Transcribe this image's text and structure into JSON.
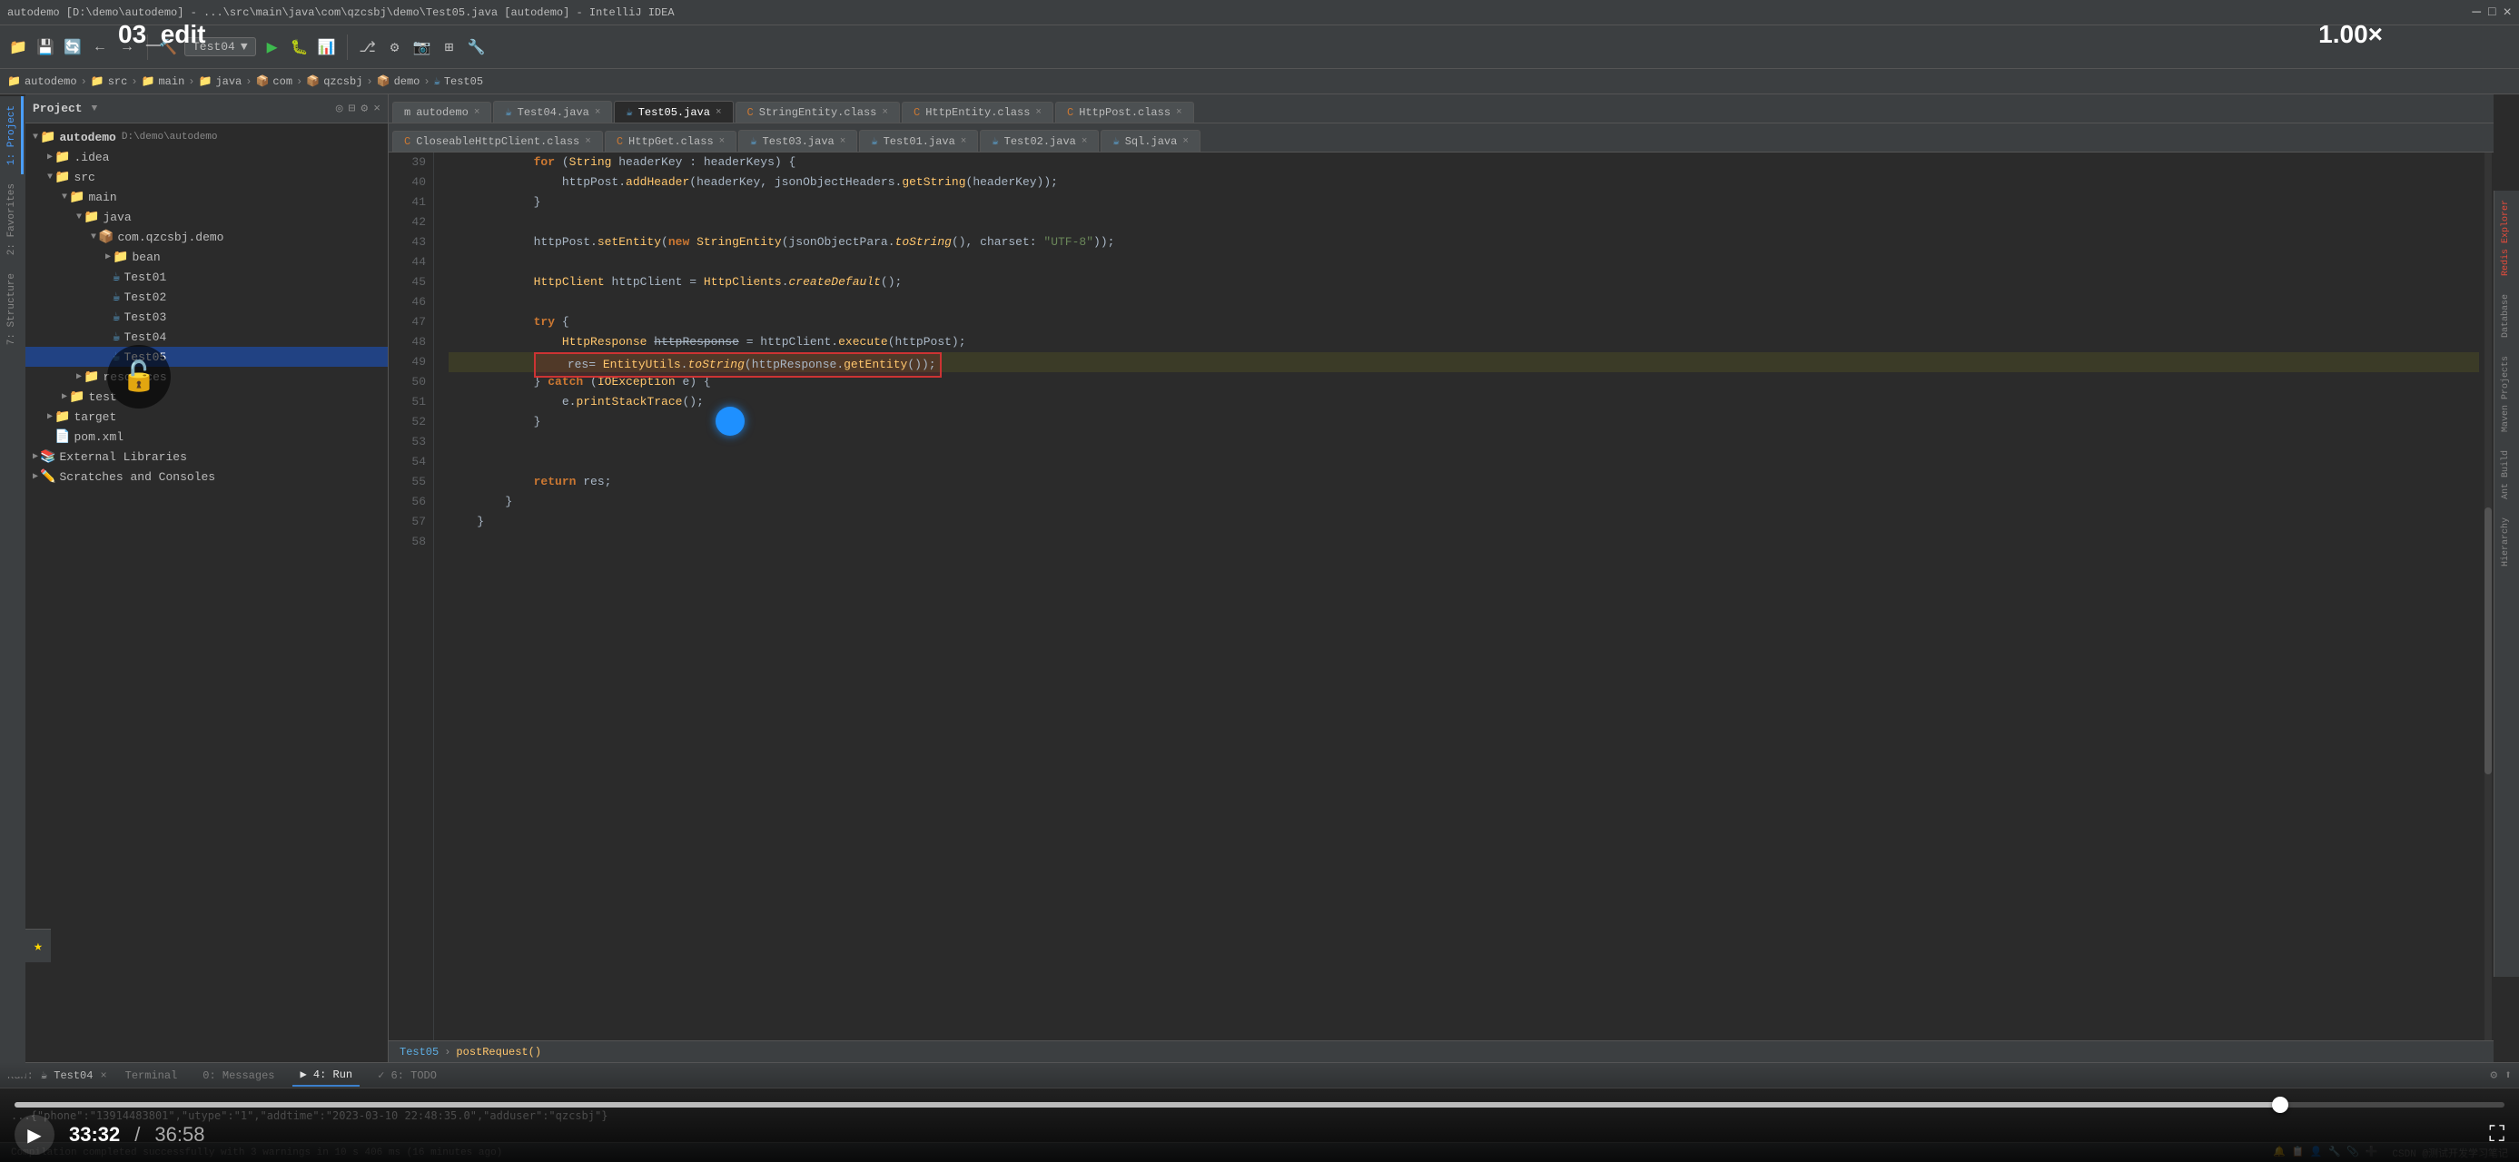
{
  "titleBar": {
    "title": "autodemo [D:\\demo\\autodemo] - ...\\src\\main\\java\\com\\qzcsbj\\demo\\Test05.java [autodemo] - IntelliJ IDEA"
  },
  "overlay": {
    "label": "03_edit",
    "scale": "1.00×"
  },
  "breadcrumb": {
    "items": [
      "autodemo",
      "src",
      "main",
      "java",
      "com",
      "qzcsbj",
      "demo",
      "Test05"
    ]
  },
  "tabBar1": {
    "tabs": [
      {
        "id": "autodemo",
        "label": "autodemo",
        "icon": "m",
        "active": false,
        "closable": true
      },
      {
        "id": "Test04",
        "label": "Test04.java",
        "icon": "☕",
        "active": false,
        "closable": true
      },
      {
        "id": "Test05",
        "label": "Test05.java",
        "icon": "☕",
        "active": true,
        "closable": true
      },
      {
        "id": "StringEntity",
        "label": "StringEntity.class",
        "icon": "C",
        "active": false,
        "closable": true
      },
      {
        "id": "HttpEntity",
        "label": "HttpEntity.class",
        "icon": "C",
        "active": false,
        "closable": true
      },
      {
        "id": "HttpPost",
        "label": "HttpPost.class",
        "icon": "C",
        "active": false,
        "closable": true
      }
    ]
  },
  "tabBar2": {
    "tabs": [
      {
        "id": "CloseableHttpClient",
        "label": "CloseableHttpClient.class",
        "icon": "C",
        "active": false,
        "closable": true
      },
      {
        "id": "HttpGet",
        "label": "HttpGet.class",
        "icon": "C",
        "active": false,
        "closable": true
      },
      {
        "id": "Test03",
        "label": "Test03.java",
        "icon": "☕",
        "active": false,
        "closable": true
      },
      {
        "id": "Test01",
        "label": "Test01.java",
        "icon": "☕",
        "active": false,
        "closable": true
      },
      {
        "id": "Test02",
        "label": "Test02.java",
        "icon": "☕",
        "active": false,
        "closable": true
      },
      {
        "id": "Sql",
        "label": "Sql.java",
        "icon": "☕",
        "active": false,
        "closable": true
      }
    ]
  },
  "codeLines": [
    {
      "num": 39,
      "text": "            for (String headerKey : headerKeys) {",
      "type": "normal"
    },
    {
      "num": 40,
      "text": "                httpPost.addHeader(headerKey, jsonObjectHeaders.getString(headerKey));",
      "type": "normal"
    },
    {
      "num": 41,
      "text": "            }",
      "type": "normal"
    },
    {
      "num": 42,
      "text": "",
      "type": "normal"
    },
    {
      "num": 43,
      "text": "            httpPost.setEntity(new StringEntity(jsonObjectPara.toString(), charset: \"UTF-8\"));",
      "type": "normal"
    },
    {
      "num": 44,
      "text": "",
      "type": "normal"
    },
    {
      "num": 45,
      "text": "            HttpClient httpClient = HttpClients.createDefault();",
      "type": "normal"
    },
    {
      "num": 46,
      "text": "",
      "type": "normal"
    },
    {
      "num": 47,
      "text": "            try {",
      "type": "normal"
    },
    {
      "num": 48,
      "text": "                HttpResponse httpResponse = httpClient.execute(httpPost);",
      "type": "normal"
    },
    {
      "num": 49,
      "text": "                res= EntityUtils.toString(httpResponse.getEntity());",
      "type": "highlighted"
    },
    {
      "num": 50,
      "text": "            } catch (IOException e) {",
      "type": "normal"
    },
    {
      "num": 51,
      "text": "                e.printStackTrace();",
      "type": "normal"
    },
    {
      "num": 52,
      "text": "            }",
      "type": "normal"
    },
    {
      "num": 53,
      "text": "",
      "type": "normal"
    },
    {
      "num": 54,
      "text": "",
      "type": "normal"
    },
    {
      "num": 55,
      "text": "            return res;",
      "type": "normal"
    },
    {
      "num": 56,
      "text": "        }",
      "type": "normal"
    },
    {
      "num": 57,
      "text": "    }",
      "type": "normal"
    },
    {
      "num": 58,
      "text": "",
      "type": "normal"
    }
  ],
  "projectTree": {
    "items": [
      {
        "level": 0,
        "label": "Project",
        "type": "header",
        "expanded": true
      },
      {
        "level": 0,
        "label": "autodemo",
        "sublabel": "D:\\demo\\autodemo",
        "type": "project",
        "expanded": true
      },
      {
        "level": 1,
        "label": ".idea",
        "type": "folder",
        "expanded": false
      },
      {
        "level": 1,
        "label": "src",
        "type": "folder",
        "expanded": true
      },
      {
        "level": 2,
        "label": "main",
        "type": "folder",
        "expanded": true
      },
      {
        "level": 3,
        "label": "java",
        "type": "folder",
        "expanded": true
      },
      {
        "level": 4,
        "label": "com.qzcsbj.demo",
        "type": "package",
        "expanded": true
      },
      {
        "level": 5,
        "label": "bean",
        "type": "folder",
        "expanded": false
      },
      {
        "level": 5,
        "label": "Test01",
        "type": "java",
        "expanded": false
      },
      {
        "level": 5,
        "label": "Test02",
        "type": "java",
        "expanded": false
      },
      {
        "level": 5,
        "label": "Test03",
        "type": "java",
        "expanded": false
      },
      {
        "level": 5,
        "label": "Test04",
        "type": "java",
        "expanded": false
      },
      {
        "level": 5,
        "label": "Test05",
        "type": "java",
        "selected": true,
        "expanded": false
      },
      {
        "level": 3,
        "label": "resources",
        "type": "folder",
        "expanded": false
      },
      {
        "level": 2,
        "label": "test",
        "type": "folder",
        "expanded": false
      },
      {
        "level": 1,
        "label": "target",
        "type": "folder",
        "expanded": false
      },
      {
        "level": 1,
        "label": "pom.xml",
        "type": "xml",
        "expanded": false
      },
      {
        "level": 0,
        "label": "External Libraries",
        "type": "folder",
        "expanded": false
      },
      {
        "level": 0,
        "label": "Scratches and Consoles",
        "type": "folder",
        "expanded": false
      }
    ]
  },
  "methodBreadcrumb": {
    "class": "Test05",
    "method": "postRequest()"
  },
  "bottomTabs": [
    {
      "label": "Terminal",
      "icon": ">_",
      "active": false
    },
    {
      "label": "0: Messages",
      "icon": "💬",
      "active": false
    },
    {
      "label": "4: Run",
      "icon": "▶",
      "active": true
    },
    {
      "label": "6: TODO",
      "icon": "✓",
      "active": false
    }
  ],
  "bottomStatus": {
    "runLabel": "Run:",
    "runConfig": "Test04",
    "outputText": "...{\"phone\":\"13914483801\",\"utype\":\"1\",\"addtime\":\"2023-03-10 22:48:35.0\",\"adduser\":\"qzcsbj\"}"
  },
  "statusBar": {
    "message": "Compilation completed successfully with 3 warnings in 10 s 406 ms (16 minutes ago)"
  },
  "videoPlayer": {
    "currentTime": "33:32",
    "totalTime": "36:58",
    "progressPercent": 91,
    "playing": false
  },
  "rightPanelTabs": [
    {
      "label": "Redis Explorer"
    },
    {
      "label": "Database"
    },
    {
      "label": "Maven Projects"
    },
    {
      "label": "Ant Build"
    },
    {
      "label": "Hierarchy"
    }
  ],
  "leftTabs": [
    {
      "label": "1: Project",
      "active": true
    },
    {
      "label": "2: Favorites",
      "active": false
    },
    {
      "label": "7: Structure",
      "active": false
    }
  ],
  "colors": {
    "bg": "#2b2b2b",
    "toolbar": "#3c3f41",
    "accent": "#4a9eff",
    "selected": "#214283",
    "highlightBorder": "#ff4444"
  }
}
